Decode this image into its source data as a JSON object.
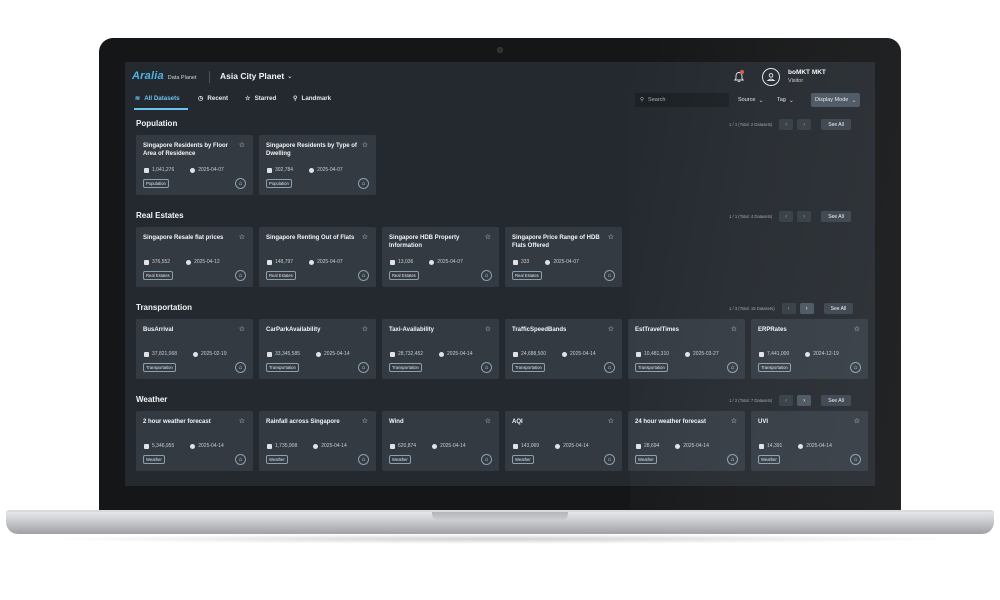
{
  "header": {
    "logo_text": "Aralia",
    "logo_sub": "Data Planet",
    "planet": "Asia City Planet",
    "user_name": "boMKT MKT",
    "user_role": "Visitor"
  },
  "nav": {
    "all": "All Datasets",
    "recent": "Recent",
    "starred": "Starred",
    "landmark": "Landmark",
    "search_placeholder": "Search",
    "source": "Source",
    "tag": "Tag",
    "display_mode": "Display Mode"
  },
  "colors": {
    "accent": "#6cc3ee",
    "screen_bg": "#24292f",
    "card_bg": "#333a42"
  },
  "sections": [
    {
      "title": "Population",
      "pager": "1 / 1  (Total: 2 Datasets)",
      "see_all": "See All",
      "cards": [
        {
          "title": "Singapore Residents by Floor Area of Residence",
          "count": "1,041,276",
          "date": "2025-04-07",
          "tag": "Population"
        },
        {
          "title": "Singapore Residents by Type of Dwelling",
          "count": "302,784",
          "date": "2025-04-07",
          "tag": "Population"
        }
      ]
    },
    {
      "title": "Real Estates",
      "pager": "1 / 1  (Total: 4 Datasets)",
      "see_all": "See All",
      "cards": [
        {
          "title": "Singapore Resale flat prices",
          "count": "376,552",
          "date": "2025-04-12",
          "tag": "Real Estates"
        },
        {
          "title": "Singapore Renting Out of Flats",
          "count": "148,797",
          "date": "2025-04-07",
          "tag": "Real Estates"
        },
        {
          "title": "Singapore HDB Property Information",
          "count": "13,036",
          "date": "2025-04-07",
          "tag": "Real Estates"
        },
        {
          "title": "Singapore Price Range of HDB Flats Offered",
          "count": "333",
          "date": "2025-04-07",
          "tag": "Real Estates"
        }
      ]
    },
    {
      "title": "Transportation",
      "pager": "1 / 3  (Total: 15 Datasets)",
      "see_all": "See All",
      "cards": [
        {
          "title": "BusArrival",
          "count": "37,821,068",
          "date": "2025-02-19",
          "tag": "Transportation"
        },
        {
          "title": "CarParkAvailability",
          "count": "33,345,585",
          "date": "2025-04-14",
          "tag": "Transportation"
        },
        {
          "title": "Taxi-Availability",
          "count": "28,732,452",
          "date": "2025-04-14",
          "tag": "Transportation"
        },
        {
          "title": "TrafficSpeedBands",
          "count": "24,688,500",
          "date": "2025-04-14",
          "tag": "Transportation"
        },
        {
          "title": "EstTravelTimes",
          "count": "10,481,310",
          "date": "2025-03-27",
          "tag": "Transportation"
        },
        {
          "title": "ERPRates",
          "count": "7,441,000",
          "date": "2024-12-19",
          "tag": "Transportation"
        }
      ]
    },
    {
      "title": "Weather",
      "pager": "1 / 2  (Total: 7 Datasets)",
      "see_all": "See All",
      "cards": [
        {
          "title": "2 hour weather forecast",
          "count": "5,346,955",
          "date": "2025-04-14",
          "tag": "Weather"
        },
        {
          "title": "Rainfall across Singapore",
          "count": "1,735,908",
          "date": "2025-04-14",
          "tag": "Weather"
        },
        {
          "title": "Wind",
          "count": "620,874",
          "date": "2025-04-14",
          "tag": "Weather"
        },
        {
          "title": "AQI",
          "count": "143,069",
          "date": "2025-04-14",
          "tag": "Weather"
        },
        {
          "title": "24 hour weather forecast",
          "count": "28,694",
          "date": "2025-04-14",
          "tag": "Weather"
        },
        {
          "title": "UVI",
          "count": "14,391",
          "date": "2025-04-14",
          "tag": "Weather"
        }
      ]
    }
  ]
}
